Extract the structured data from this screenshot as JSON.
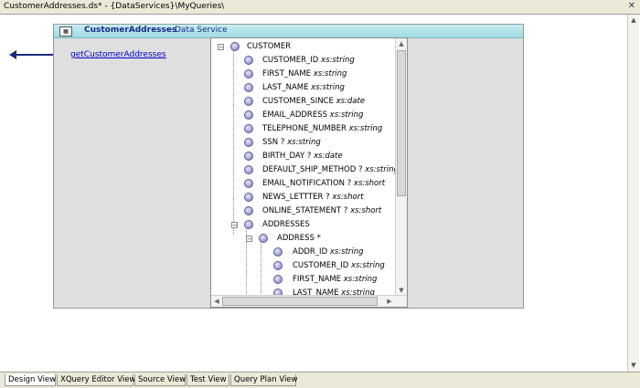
{
  "window": {
    "title": "CustomerAddresses.ds* - {DataServices}\\MyQueries\\"
  },
  "data_service": {
    "name": "CustomerAddresses",
    "type_label": "Data Service",
    "function_link": "getCustomerAddresses"
  },
  "tree": [
    {
      "text": "CUSTOMER",
      "type": "",
      "expander": "−"
    },
    {
      "text": "CUSTOMER_ID",
      "type": "xs:string"
    },
    {
      "text": "FIRST_NAME",
      "type": "xs:string"
    },
    {
      "text": "LAST_NAME",
      "type": "xs:string"
    },
    {
      "text": "CUSTOMER_SINCE",
      "type": "xs:date"
    },
    {
      "text": "EMAIL_ADDRESS",
      "type": "xs:string"
    },
    {
      "text": "TELEPHONE_NUMBER",
      "type": "xs:string"
    },
    {
      "text": "SSN ?",
      "type": "xs:string"
    },
    {
      "text": "BIRTH_DAY ?",
      "type": "xs:date"
    },
    {
      "text": "DEFAULT_SHIP_METHOD ?",
      "type": "xs:string"
    },
    {
      "text": "EMAIL_NOTIFICATION ?",
      "type": "xs:short"
    },
    {
      "text": "NEWS_LETTTER ?",
      "type": "xs:short"
    },
    {
      "text": "ONLINE_STATEMENT ?",
      "type": "xs:short"
    },
    {
      "text": "ADDRESSES",
      "type": "",
      "expander": "−"
    },
    {
      "text": "ADDRESS *",
      "type": "",
      "expander": "−"
    },
    {
      "text": "ADDR_ID",
      "type": "xs:string"
    },
    {
      "text": "CUSTOMER_ID",
      "type": "xs:string"
    },
    {
      "text": "FIRST_NAME",
      "type": "xs:string"
    },
    {
      "text": "LAST_NAME",
      "type": "xs:string"
    }
  ],
  "tabs": [
    {
      "label": "Design View",
      "active": true
    },
    {
      "label": "XQuery Editor View",
      "active": false
    },
    {
      "label": "Source View",
      "active": false
    },
    {
      "label": "Test View",
      "active": false
    },
    {
      "label": "Query Plan View",
      "active": false
    }
  ]
}
